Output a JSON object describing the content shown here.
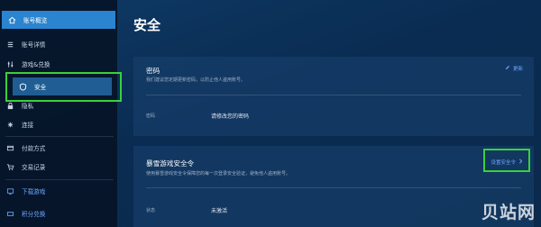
{
  "sidebar": {
    "items": [
      {
        "label": "账号概览",
        "icon": "home-icon"
      },
      {
        "label": "账号详情",
        "icon": "menu-icon"
      },
      {
        "label": "游戏&兑换",
        "icon": "sliders-icon"
      },
      {
        "label": "安全",
        "icon": "shield-icon"
      },
      {
        "label": "隐私",
        "icon": "lock-icon"
      },
      {
        "label": "连接",
        "icon": "link-icon"
      },
      {
        "label": "付款方式",
        "icon": "card-icon"
      },
      {
        "label": "交易记录",
        "icon": "cart-icon"
      },
      {
        "label": "下载游戏",
        "icon": "download-icon"
      },
      {
        "label": "积分兑换",
        "icon": "ticket-icon"
      }
    ]
  },
  "page": {
    "title": "安全"
  },
  "password_card": {
    "title": "密码",
    "description": "我们建议您定期更新密码，以防止他人盗用账号。",
    "edit_label": "更新",
    "row_label": "密码",
    "row_value": "请修改您的密码"
  },
  "authenticator_card": {
    "title": "暴雪游戏安全令",
    "description": "使用暴雪游戏安全令保障您的每一次登录安全验证，避免他人盗用账号。",
    "setup_label": "设置安全令",
    "status_label": "状态",
    "status_value": "未激活"
  },
  "watermark": "贝站网",
  "colors": {
    "highlight": "#39d13a",
    "accent": "#2b84d0",
    "link": "#6fa8ff"
  }
}
